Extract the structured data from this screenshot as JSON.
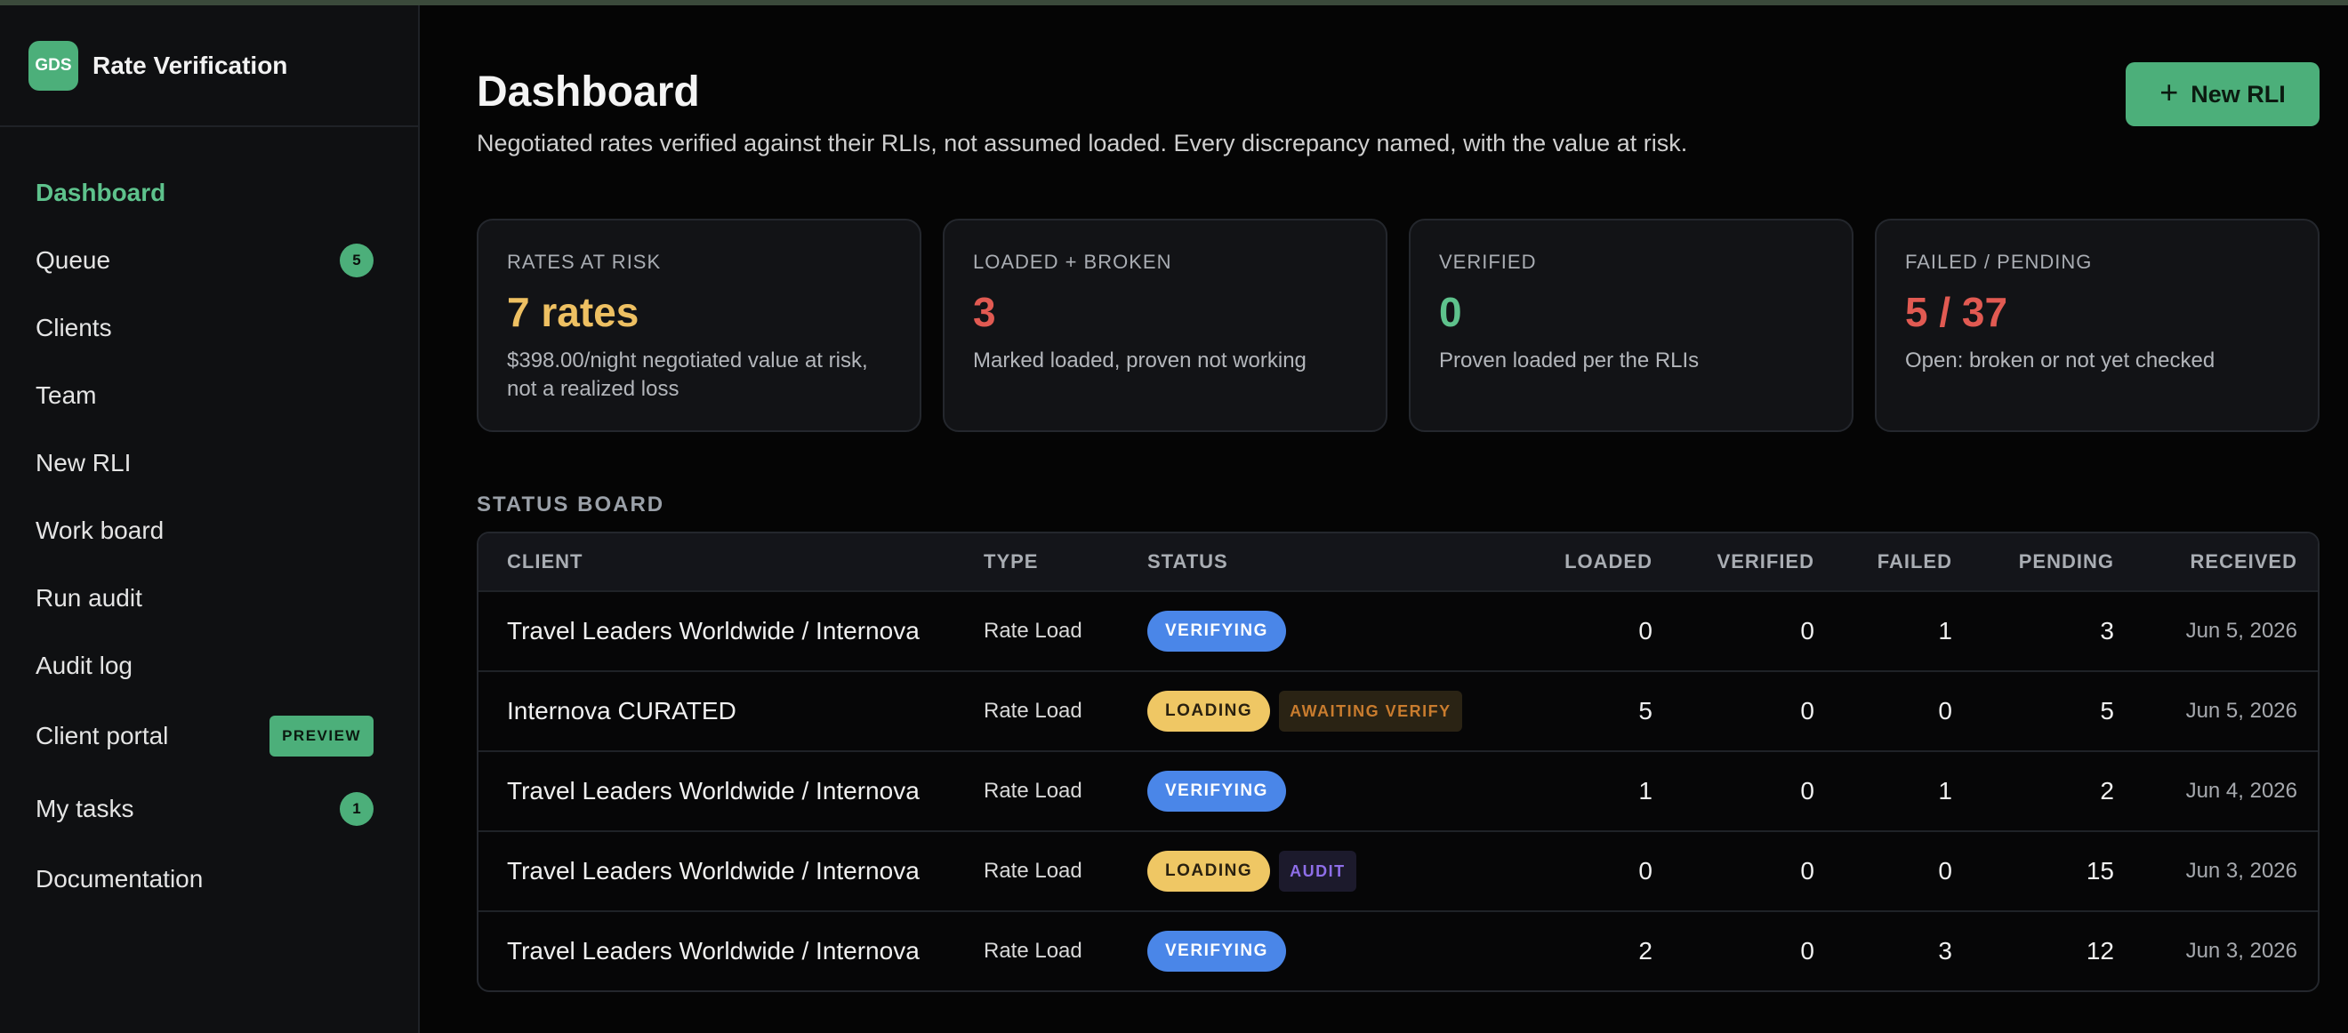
{
  "brand": {
    "logo_text": "GDS",
    "title": "Rate Verification"
  },
  "sidebar": {
    "items": [
      {
        "label": "Dashboard",
        "active": true
      },
      {
        "label": "Queue",
        "badge": "5"
      },
      {
        "label": "Clients"
      },
      {
        "label": "Team"
      },
      {
        "label": "New RLI"
      },
      {
        "label": "Work board"
      },
      {
        "label": "Run audit"
      },
      {
        "label": "Audit log"
      },
      {
        "label": "Client portal",
        "badge": "PREVIEW"
      },
      {
        "label": "My tasks",
        "badge": "1"
      },
      {
        "label": "Documentation"
      }
    ]
  },
  "header": {
    "title": "Dashboard",
    "subtitle": "Negotiated rates verified against their RLIs, not assumed loaded. Every discrepancy named, with the value at risk.",
    "new_button": {
      "icon": "plus-icon",
      "label": "New RLI"
    }
  },
  "stats": [
    {
      "label": "RATES AT RISK",
      "value": "7 rates",
      "color": "#eec062",
      "desc": "$398.00/night negotiated value at risk, not a realized loss"
    },
    {
      "label": "LOADED + BROKEN",
      "value": "3",
      "color": "#e15a52",
      "desc": "Marked loaded, proven not working"
    },
    {
      "label": "VERIFIED",
      "value": "0",
      "color": "#5ec28c",
      "desc": "Proven loaded per the RLIs"
    },
    {
      "label": "FAILED / PENDING",
      "value": "5 / 37",
      "color": "#e15a52",
      "desc": "Open: broken or not yet checked"
    }
  ],
  "status_board": {
    "label": "STATUS BOARD",
    "columns": [
      "CLIENT",
      "TYPE",
      "STATUS",
      "LOADED",
      "VERIFIED",
      "FAILED",
      "PENDING",
      "RECEIVED"
    ],
    "rows": [
      {
        "client": "Travel Leaders Worldwide / Internova",
        "type": "Rate Load",
        "status": "VERIFYING",
        "tag": "",
        "loaded": "0",
        "verified": "0",
        "failed": "1",
        "pending": "3",
        "received": "Jun 5, 2026"
      },
      {
        "client": "Internova CURATED",
        "type": "Rate Load",
        "status": "LOADING",
        "tag": "AWAITING VERIFY",
        "loaded": "5",
        "verified": "0",
        "failed": "0",
        "pending": "5",
        "received": "Jun 5, 2026"
      },
      {
        "client": "Travel Leaders Worldwide / Internova",
        "type": "Rate Load",
        "status": "VERIFYING",
        "tag": "",
        "loaded": "1",
        "verified": "0",
        "failed": "1",
        "pending": "2",
        "received": "Jun 4, 2026"
      },
      {
        "client": "Travel Leaders Worldwide / Internova",
        "type": "Rate Load",
        "status": "LOADING",
        "tag": "AUDIT",
        "loaded": "0",
        "verified": "0",
        "failed": "0",
        "pending": "15",
        "received": "Jun 3, 2026"
      },
      {
        "client": "Travel Leaders Worldwide / Internova",
        "type": "Rate Load",
        "status": "VERIFYING",
        "tag": "",
        "loaded": "2",
        "verified": "0",
        "failed": "3",
        "pending": "12",
        "received": "Jun 3, 2026"
      }
    ]
  },
  "colors": {
    "accent": "#4caf7a",
    "verified": "#5ec28c",
    "failed_nonzero": "#e15a52",
    "verifying": "#4a86e8",
    "loading": "#efc764"
  }
}
